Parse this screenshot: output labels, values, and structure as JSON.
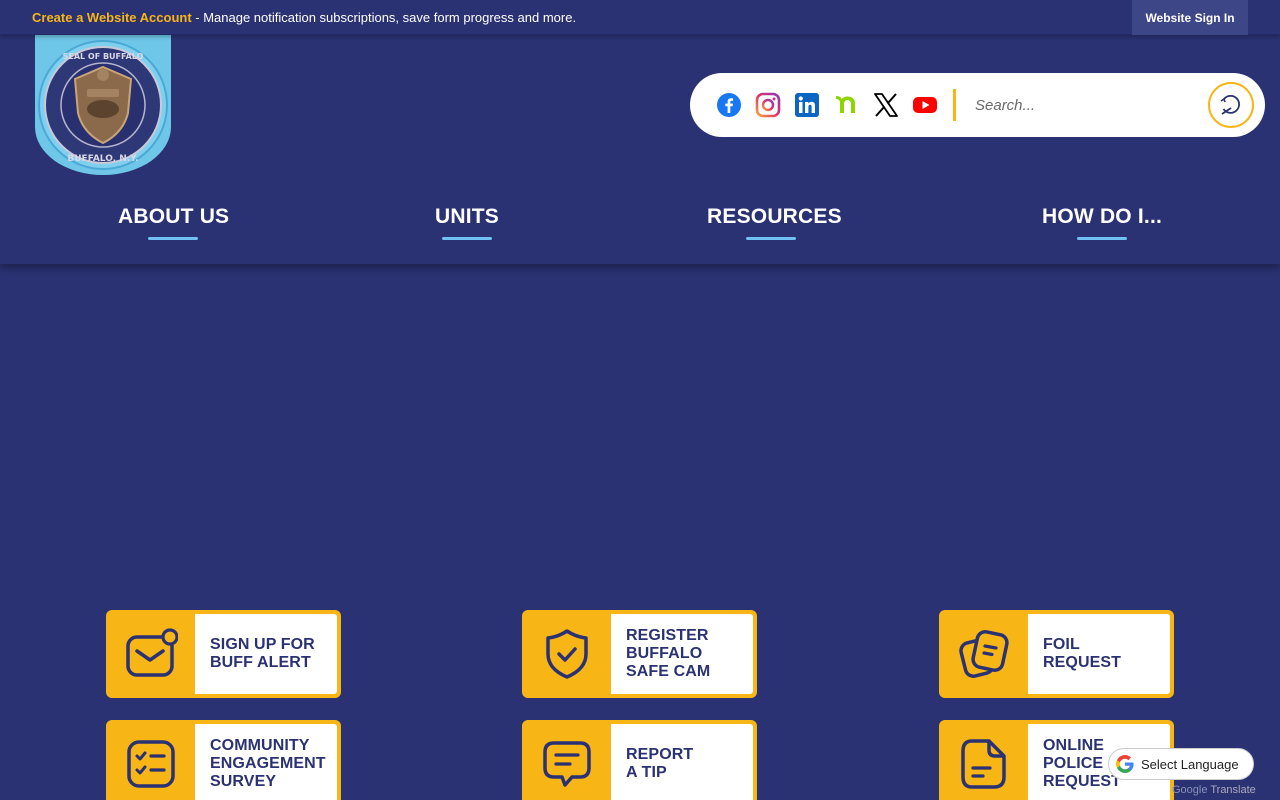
{
  "topbar": {
    "create_account_link": "Create a Website Account",
    "message": " - Manage notification subscriptions, save form progress and more.",
    "signin_label": "Website Sign In"
  },
  "logo": {
    "alt_text": "SEAL OF BUFFALO POLICE DEPARTMENT BUFFALO, N.Y."
  },
  "social": [
    {
      "name": "facebook-icon",
      "color": "#1877f2"
    },
    {
      "name": "instagram-icon",
      "color": "#e1306c"
    },
    {
      "name": "linkedin-icon",
      "color": "#0a66c2"
    },
    {
      "name": "nextdoor-icon",
      "color": "#8ed500"
    },
    {
      "name": "x-icon",
      "color": "#000000"
    },
    {
      "name": "youtube-icon",
      "color": "#ff0000"
    }
  ],
  "search": {
    "placeholder": "Search..."
  },
  "nav": {
    "items": [
      "ABOUT US",
      "UNITS",
      "RESOURCES",
      "HOW DO I..."
    ]
  },
  "cards": [
    {
      "label": "SIGN UP FOR\nBUFF ALERT",
      "icon": "envelope-notification-icon"
    },
    {
      "label": "REGISTER\nBUFFALO\nSAFE CAM",
      "icon": "shield-check-icon"
    },
    {
      "label": "FOIL\nREQUEST",
      "icon": "documents-icon"
    },
    {
      "label": "COMMUNITY\nENGAGEMENT\nSURVEY",
      "icon": "checklist-icon"
    },
    {
      "label": "REPORT\nA TIP",
      "icon": "chat-bubble-icon"
    },
    {
      "label": "ONLINE\nPOLICE\nREQUEST",
      "icon": "document-icon"
    }
  ],
  "translate": {
    "label": "Select Language",
    "powered_by": "Google",
    "powered_suffix": "Translate"
  },
  "colors": {
    "background": "#2b3273",
    "accent": "#f7b516",
    "nav_underline": "#6ec1f0"
  }
}
